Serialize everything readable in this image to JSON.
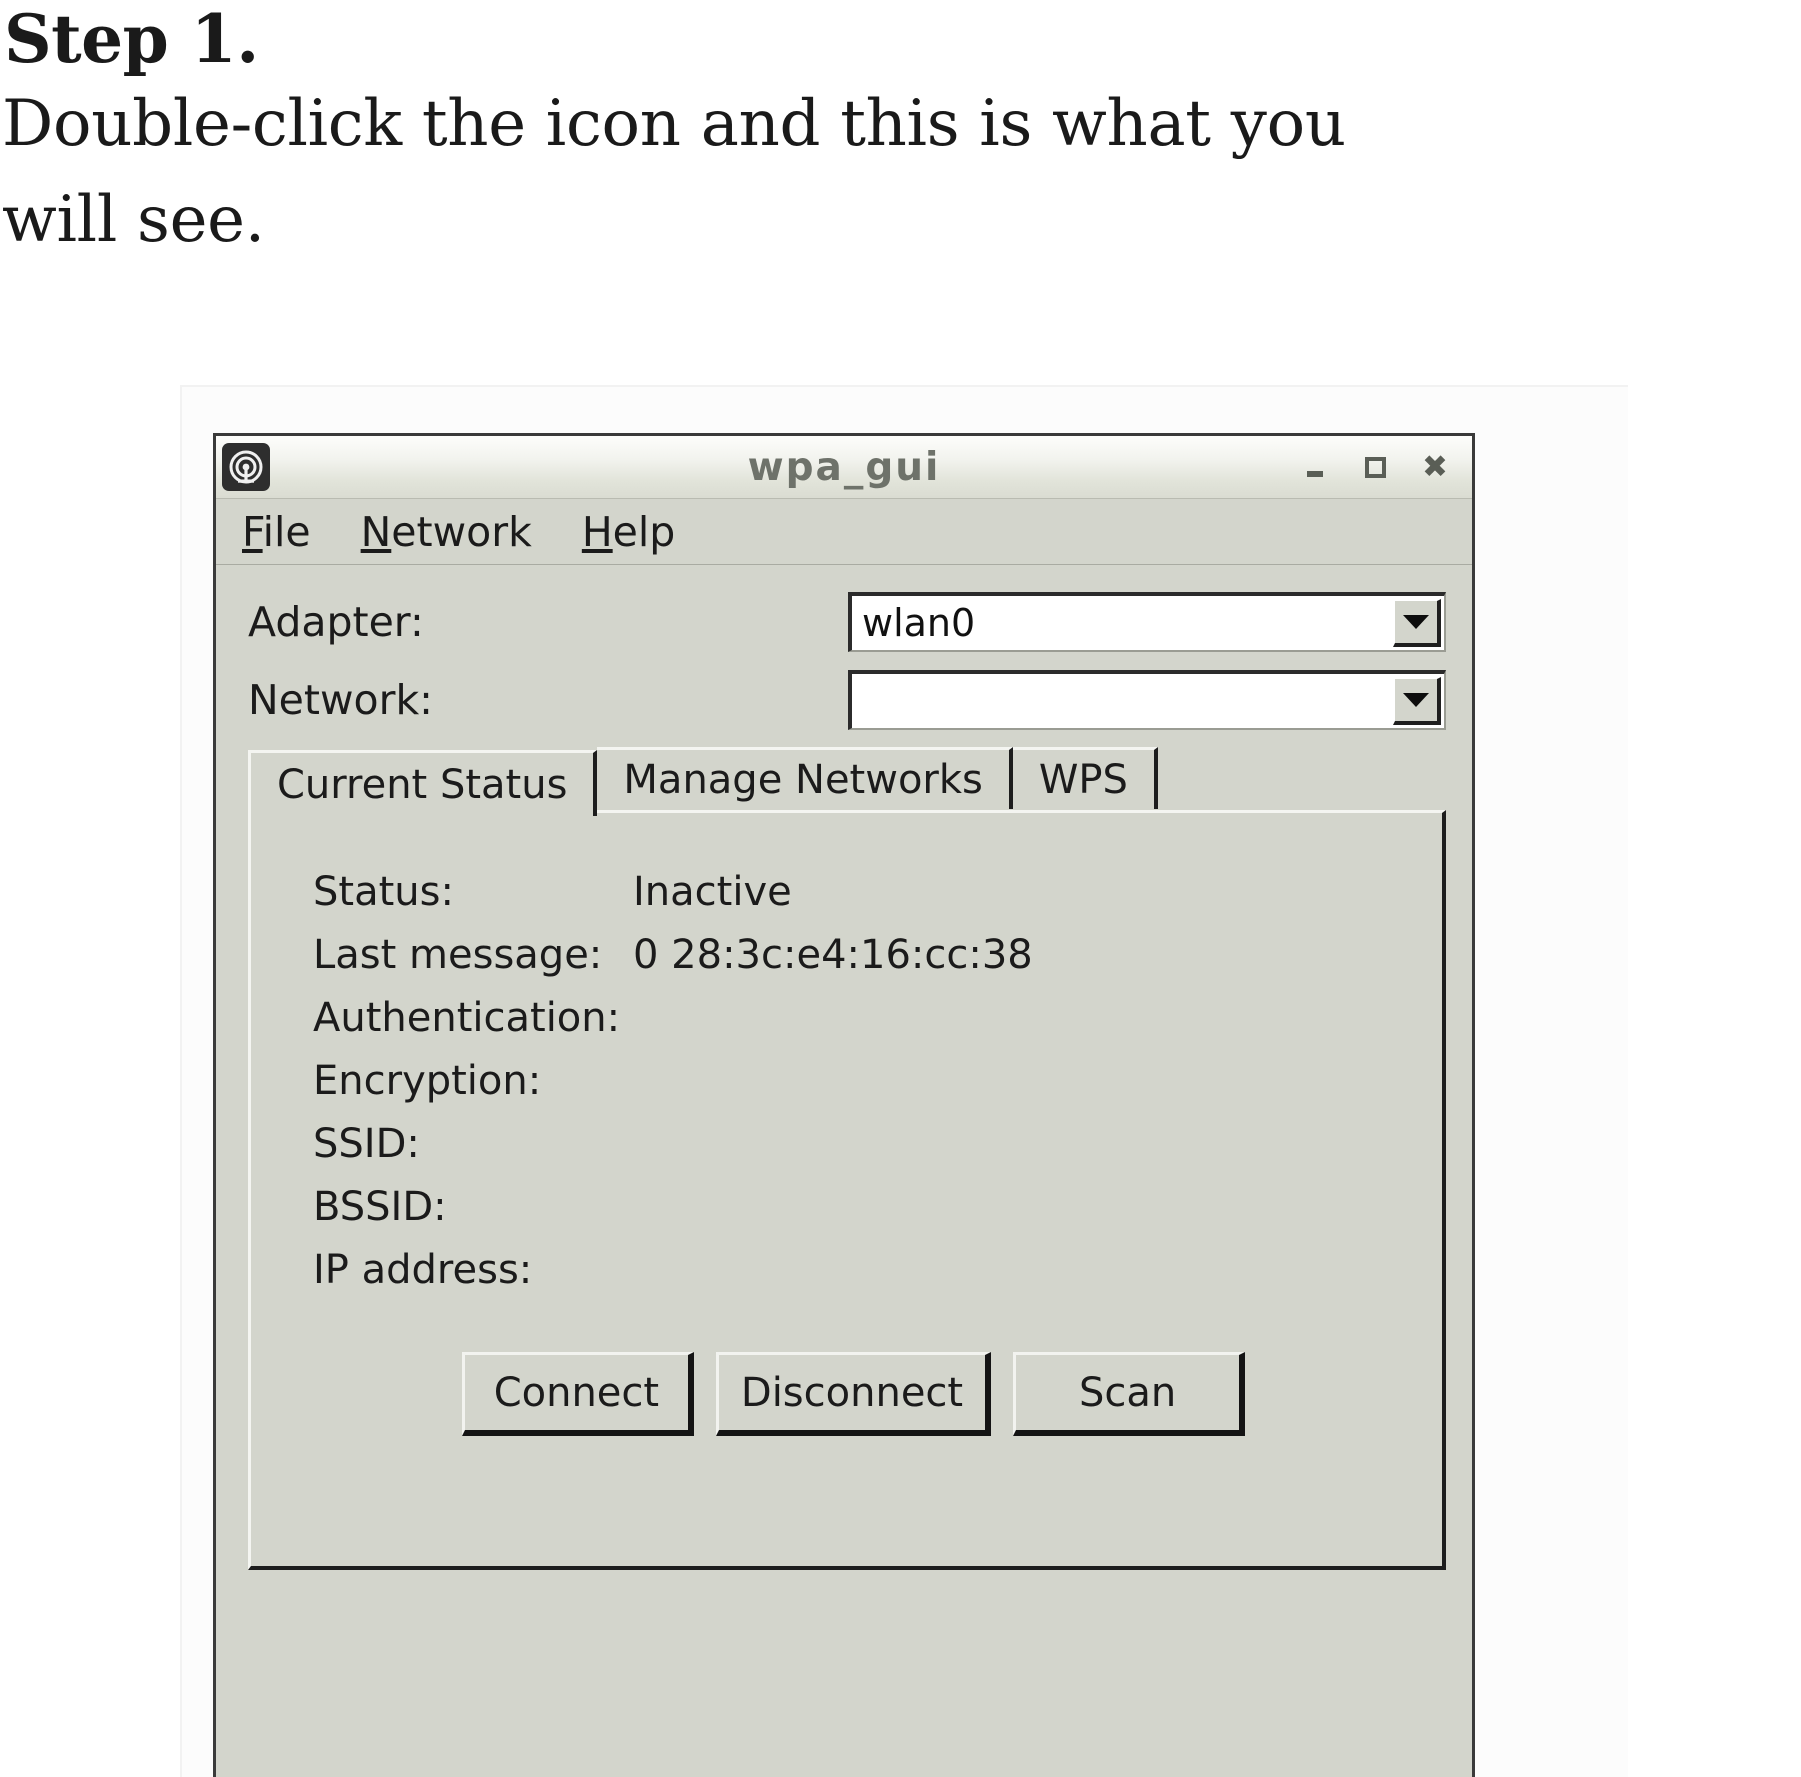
{
  "instruction": {
    "step_title": "Step 1.",
    "line_1": "Double-click the icon and this is what you",
    "line_2": "will see."
  },
  "window": {
    "title": "wpa_gui",
    "icon": "wireless-signal-icon",
    "controls": {
      "minimize": "minimize-icon",
      "maximize": "maximize-icon",
      "close": "close-icon"
    }
  },
  "menubar": {
    "items": [
      {
        "mnemonic": "F",
        "rest": "ile"
      },
      {
        "mnemonic": "N",
        "rest": "etwork"
      },
      {
        "mnemonic": "H",
        "rest": "elp"
      }
    ]
  },
  "fields": {
    "adapter": {
      "label": "Adapter:",
      "value": "wlan0",
      "arrow": "chevron-down-icon"
    },
    "network": {
      "label": "Network:",
      "value": "",
      "arrow": "chevron-down-icon"
    }
  },
  "tabs": [
    {
      "label": "Current Status",
      "active": true
    },
    {
      "label": "Manage Networks",
      "active": false
    },
    {
      "label": "WPS",
      "active": false
    }
  ],
  "current_status": {
    "rows": [
      {
        "label": "Status:",
        "value": "Inactive"
      },
      {
        "label": "Last message:",
        "value": "0 28:3c:e4:16:cc:38"
      },
      {
        "label": "Authentication:",
        "value": ""
      },
      {
        "label": "Encryption:",
        "value": ""
      },
      {
        "label": "SSID:",
        "value": ""
      },
      {
        "label": "BSSID:",
        "value": ""
      },
      {
        "label": "IP address:",
        "value": ""
      }
    ],
    "buttons": [
      {
        "label": "Connect"
      },
      {
        "label": "Disconnect"
      },
      {
        "label": "Scan"
      }
    ]
  },
  "colors": {
    "window_face": "#d3d5cc",
    "titlebar_text": "#6e726a",
    "text": "#1b1b1b",
    "field_background": "#ffffff",
    "border_dark": "#1d1d1d",
    "border_light": "#f4f5f1"
  }
}
